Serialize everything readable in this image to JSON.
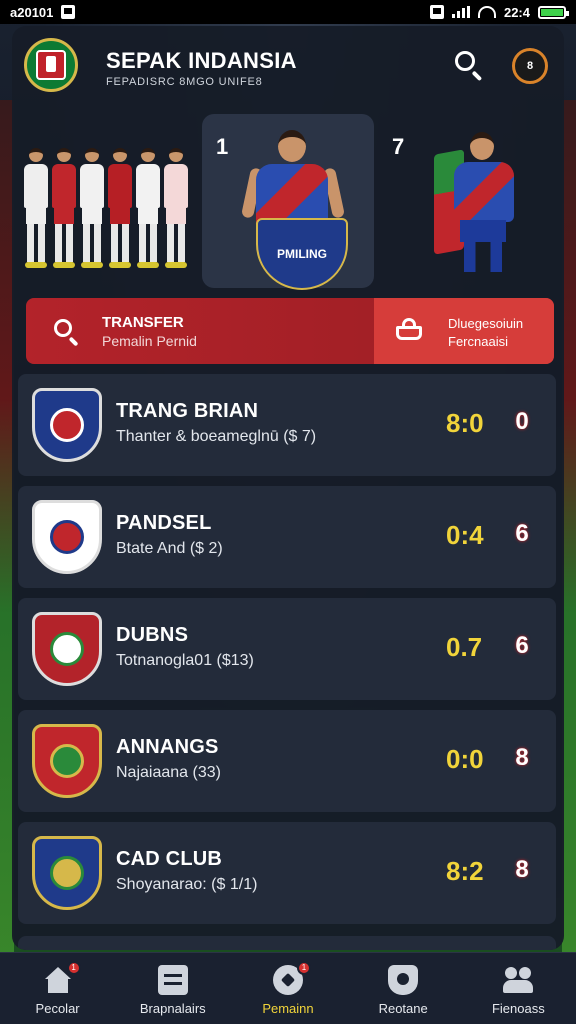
{
  "status_bar": {
    "left_text": "a20101",
    "time": "22:4"
  },
  "header": {
    "title": "SEPAK INDANSIA",
    "subtitle": "FEPADISRC 8MGO UNIFE8",
    "profile_initials": "8",
    "logo_icon": "club-logo-icon",
    "search_icon": "search-icon"
  },
  "hero": {
    "rank_left": "1",
    "rank_right": "7",
    "featured_badge": "PMILING"
  },
  "transfer": {
    "title": "TRANSFER",
    "subtitle": "Pemalin Pernid",
    "right_line1": "Dluegesoiuin",
    "right_line2": "Fercnaaisi",
    "search_icon": "search-icon",
    "basket_icon": "basket-icon"
  },
  "clubs": [
    {
      "name": "TRANG BRIAN",
      "sub": "Thanter & boeameglnū ($ 7)",
      "score": "8:0",
      "badge": "0",
      "crest_color": "#1f3a8a",
      "crest_accent": "#c0262c"
    },
    {
      "name": "PANDSEL",
      "sub": "Btate And ($ 2)",
      "score": "0:4",
      "badge": "6",
      "crest_color": "#ffffff",
      "crest_accent": "#c0262c"
    },
    {
      "name": "DUBNS",
      "sub": "Totnanogla01 ($13)",
      "score": "0.7",
      "badge": "6",
      "crest_color": "#b3232a",
      "crest_accent": "#ffffff"
    },
    {
      "name": "ANNANGS",
      "sub": "Najaiaana (33)",
      "score": "0:0",
      "badge": "8",
      "crest_color": "#c0262c",
      "crest_accent": "#2a8a3a"
    },
    {
      "name": "CAD CLUB",
      "sub": "Shoyanarao: ($ 1/1)",
      "score": "8:2",
      "badge": "8",
      "crest_color": "#1f3a8a",
      "crest_accent": "#d6b84a"
    }
  ],
  "bottom_nav": [
    {
      "label": "Pecolar",
      "icon": "home-icon",
      "badge": "1",
      "active": false
    },
    {
      "label": "Brapnalairs",
      "icon": "list-icon",
      "badge": "",
      "active": false
    },
    {
      "label": "Pemainn",
      "icon": "ball-icon",
      "badge": "1",
      "active": true
    },
    {
      "label": "Reotane",
      "icon": "shield-icon",
      "badge": "",
      "active": false
    },
    {
      "label": "Fienoass",
      "icon": "people-icon",
      "badge": "",
      "active": false
    }
  ],
  "colors": {
    "accent_red": "#b3232a",
    "score_yellow": "#f1d43a",
    "card_bg": "#232b3a",
    "panel_bg": "#161c28"
  }
}
